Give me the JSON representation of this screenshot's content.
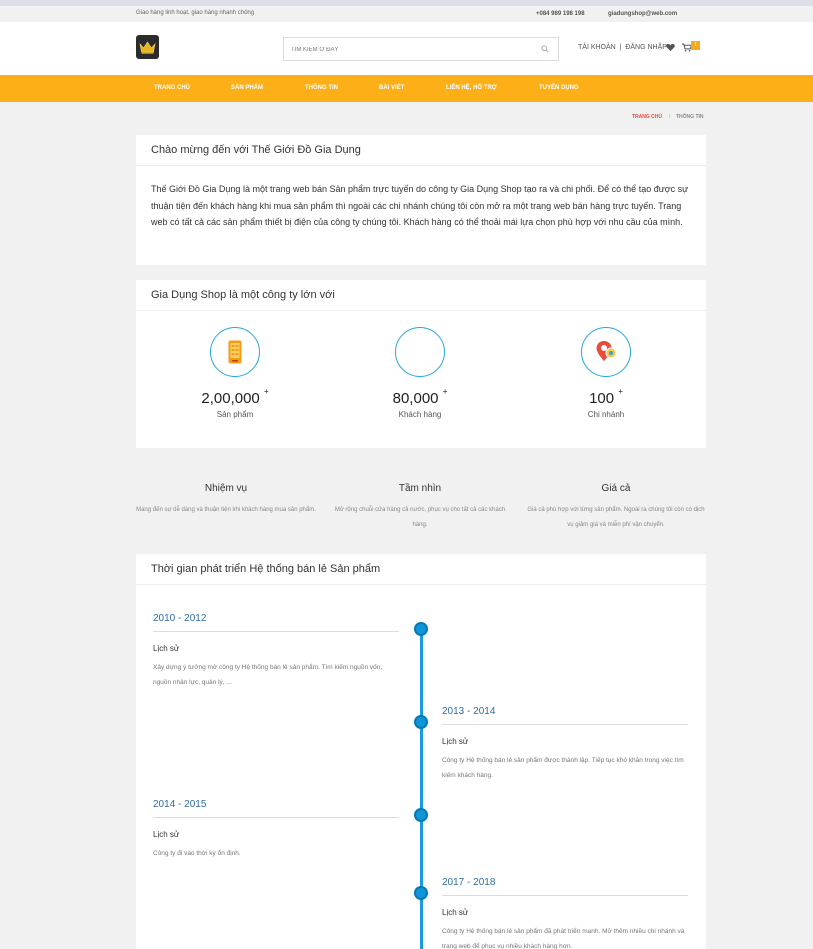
{
  "topbar": {
    "tagline": "Giao hàng linh hoạt, giao hàng nhanh chóng",
    "phone": "+084 989 198 198",
    "email": "giadungshop@web.com"
  },
  "header": {
    "search_placeholder": "TÌM KIẾM Ở ĐÂY",
    "account_label": "TÀI KHOẢN  |  ĐĂNG NHẬP",
    "cart_count": "1"
  },
  "nav": [
    "TRANG CHỦ",
    "SẢN PHẨM",
    "THÔNG TIN",
    "BÀI VIẾT",
    "LIÊN HỆ, HỖ TRỢ",
    "TUYỂN DỤNG"
  ],
  "breadcrumb": {
    "home": "TRANG CHỦ",
    "sep": "/",
    "current": "THÔNG TIN"
  },
  "intro": {
    "title": "Chào mừng đến với Thế Giới Đồ Gia Dụng",
    "body": "Thế Giới Đồ Gia Dụng là một trang web bán Sản phẩm trực tuyến do công ty Gia Dụng Shop tạo ra và chi phối. Để có thể tạo được sự thuận tiện đến khách hàng khi mua sản phẩm thì ngoài các chi nhánh chúng tôi còn mở ra một trang web bán hàng trực tuyến. Trang web có tất cả các sản phẩm thiết bị điện của công ty chúng tôi. Khách hàng có thể thoải mái lựa chọn phù hợp với nhu cầu của mình."
  },
  "stats": {
    "title": "Gia Dụng Shop là một công ty lớn với",
    "items": [
      {
        "number": "2,00,000",
        "sup": "+",
        "label": "Sản phẩm",
        "icon": "phone-icon"
      },
      {
        "number": "80,000",
        "sup": "+",
        "label": "Khách hàng",
        "icon": ""
      },
      {
        "number": "100",
        "sup": "+",
        "label": "Chi nhánh",
        "icon": "map-pin-icon"
      }
    ]
  },
  "values": [
    {
      "title": "Nhiệm vụ",
      "desc": "Mang đến sự dễ dàng và thuận tiện khi khách hàng mua sản phẩm."
    },
    {
      "title": "Tầm nhìn",
      "desc": "Mở rộng chuỗi cửa hàng cả nước, phục vụ cho tất cả các khách hàng."
    },
    {
      "title": "Giá cả",
      "desc": "Giá cả phù hợp với từng sản phẩm. Ngoài ra chúng tôi còn có dịch vụ giảm giá và miễn phí vận chuyển."
    }
  ],
  "timeline": {
    "title": "Thời gian phát triển Hệ thống bán lẻ Sản phẩm",
    "items": [
      {
        "years": "2010 - 2012",
        "label": "Lịch sử",
        "desc": "Xây dựng ý tưởng mở công ty Hệ thống bán lẻ sản phẩm. Tìm kiếm nguồn vốn, nguồn nhân lực, quản lý, ..."
      },
      {
        "years": "2013 - 2014",
        "label": "Lịch sử",
        "desc": "Công ty Hệ thống bán lẻ sản phẩm được thành lập. Tiếp tục khó khăn trong việc tìm kiếm khách hàng."
      },
      {
        "years": "2014 - 2015",
        "label": "Lịch sử",
        "desc": "Công ty đi vào thời kỳ ổn định."
      },
      {
        "years": "2017 - 2018",
        "label": "Lịch sử",
        "desc": "Công ty Hệ thống bán lẻ sản phẩm đã phát triển mạnh. Mở thêm nhiều chi nhánh và trang web để phục vụ nhiều khách hàng hơn."
      }
    ]
  },
  "colors": {
    "brand": "#fcaf17",
    "timeline": "#1a9be0",
    "link": "#2e6da4",
    "breadcrumb_home": "#e74c3c"
  }
}
